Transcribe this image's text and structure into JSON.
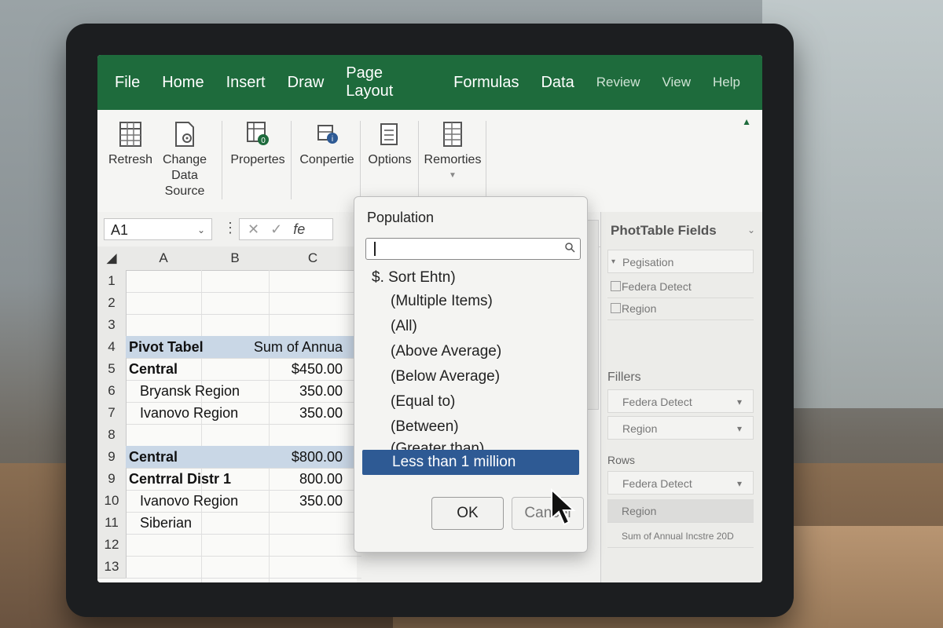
{
  "tabs": [
    "File",
    "Home",
    "Insert",
    "Draw",
    "Page Layout",
    "Formulas",
    "Data",
    "Review",
    "View",
    "Help"
  ],
  "ribbon": {
    "refresh": "Retresh",
    "change_line1": "Change",
    "change_line2": "Data",
    "change_line3": "Source",
    "properties": "Propertes",
    "connections": "Conpertie",
    "options": "Options",
    "remorties": "Remorties"
  },
  "formula_bar": {
    "name_box": "A1",
    "fx": "fe"
  },
  "grid": {
    "columns": [
      "A",
      "B",
      "C"
    ],
    "rows": [
      {
        "num": "1",
        "a": "",
        "c": ""
      },
      {
        "num": "2",
        "a": "",
        "c": ""
      },
      {
        "num": "3",
        "a": "",
        "c": ""
      },
      {
        "num": "4",
        "a": "Pivot Tabel",
        "c": "Sum of Annua"
      },
      {
        "num": "5",
        "a": "Central",
        "c": "$450.00"
      },
      {
        "num": "6",
        "a": "Bryansk Region",
        "c": "350.00"
      },
      {
        "num": "7",
        "a": "Ivanovo Region",
        "c": "350.00"
      },
      {
        "num": "8",
        "a": "",
        "c": ""
      },
      {
        "num": "9",
        "a": "Central",
        "c": "$800.00"
      },
      {
        "num": "9",
        "a": "Centrral Distr 1",
        "c": "800.00"
      },
      {
        "num": "10",
        "a": "Ivanovo Region",
        "c": "350.00"
      },
      {
        "num": "11",
        "a": "Siberian",
        "c": ""
      },
      {
        "num": "12",
        "a": "",
        "c": ""
      },
      {
        "num": "13",
        "a": "",
        "c": ""
      }
    ]
  },
  "dialog": {
    "title": "Population",
    "search_value": "",
    "sort": "$. Sort Ehtn)",
    "options": [
      "(Multiple Items)",
      "(All)",
      "(Above Average)",
      "(Below Average)",
      "(Equal to)",
      "(Between)",
      "(Greater than)"
    ],
    "selected": "Less than 1 million",
    "ok": "OK",
    "cancel": "Cancel"
  },
  "pane": {
    "title": "PhotTable Fields",
    "fields": [
      "Pegisation",
      "Federa Detect",
      "Region"
    ],
    "filters_label": "Fillers",
    "filters": [
      "Federa Detect",
      "Region"
    ],
    "rows_label": "Rows",
    "rows": [
      "Federa Detect",
      "Region"
    ],
    "values": [
      "Sum of Annual Incstre 20D"
    ]
  },
  "colors": {
    "ribbon_green": "#1e6b3c",
    "selection_blue": "#2e5a94",
    "pivot_band": "#c9d7e6"
  }
}
